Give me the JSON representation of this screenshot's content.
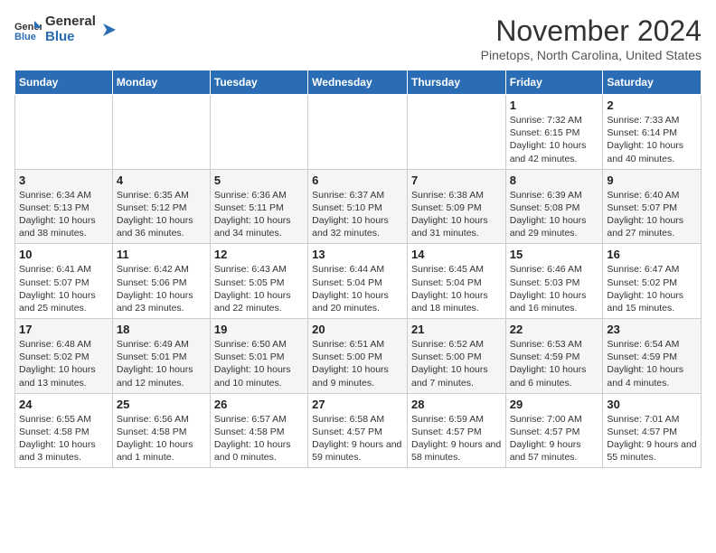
{
  "logo": {
    "line1": "General",
    "line2": "Blue"
  },
  "title": "November 2024",
  "subtitle": "Pinetops, North Carolina, United States",
  "days_of_week": [
    "Sunday",
    "Monday",
    "Tuesday",
    "Wednesday",
    "Thursday",
    "Friday",
    "Saturday"
  ],
  "weeks": [
    [
      {
        "day": "",
        "info": ""
      },
      {
        "day": "",
        "info": ""
      },
      {
        "day": "",
        "info": ""
      },
      {
        "day": "",
        "info": ""
      },
      {
        "day": "",
        "info": ""
      },
      {
        "day": "1",
        "info": "Sunrise: 7:32 AM\nSunset: 6:15 PM\nDaylight: 10 hours and 42 minutes."
      },
      {
        "day": "2",
        "info": "Sunrise: 7:33 AM\nSunset: 6:14 PM\nDaylight: 10 hours and 40 minutes."
      }
    ],
    [
      {
        "day": "3",
        "info": "Sunrise: 6:34 AM\nSunset: 5:13 PM\nDaylight: 10 hours and 38 minutes."
      },
      {
        "day": "4",
        "info": "Sunrise: 6:35 AM\nSunset: 5:12 PM\nDaylight: 10 hours and 36 minutes."
      },
      {
        "day": "5",
        "info": "Sunrise: 6:36 AM\nSunset: 5:11 PM\nDaylight: 10 hours and 34 minutes."
      },
      {
        "day": "6",
        "info": "Sunrise: 6:37 AM\nSunset: 5:10 PM\nDaylight: 10 hours and 32 minutes."
      },
      {
        "day": "7",
        "info": "Sunrise: 6:38 AM\nSunset: 5:09 PM\nDaylight: 10 hours and 31 minutes."
      },
      {
        "day": "8",
        "info": "Sunrise: 6:39 AM\nSunset: 5:08 PM\nDaylight: 10 hours and 29 minutes."
      },
      {
        "day": "9",
        "info": "Sunrise: 6:40 AM\nSunset: 5:07 PM\nDaylight: 10 hours and 27 minutes."
      }
    ],
    [
      {
        "day": "10",
        "info": "Sunrise: 6:41 AM\nSunset: 5:07 PM\nDaylight: 10 hours and 25 minutes."
      },
      {
        "day": "11",
        "info": "Sunrise: 6:42 AM\nSunset: 5:06 PM\nDaylight: 10 hours and 23 minutes."
      },
      {
        "day": "12",
        "info": "Sunrise: 6:43 AM\nSunset: 5:05 PM\nDaylight: 10 hours and 22 minutes."
      },
      {
        "day": "13",
        "info": "Sunrise: 6:44 AM\nSunset: 5:04 PM\nDaylight: 10 hours and 20 minutes."
      },
      {
        "day": "14",
        "info": "Sunrise: 6:45 AM\nSunset: 5:04 PM\nDaylight: 10 hours and 18 minutes."
      },
      {
        "day": "15",
        "info": "Sunrise: 6:46 AM\nSunset: 5:03 PM\nDaylight: 10 hours and 16 minutes."
      },
      {
        "day": "16",
        "info": "Sunrise: 6:47 AM\nSunset: 5:02 PM\nDaylight: 10 hours and 15 minutes."
      }
    ],
    [
      {
        "day": "17",
        "info": "Sunrise: 6:48 AM\nSunset: 5:02 PM\nDaylight: 10 hours and 13 minutes."
      },
      {
        "day": "18",
        "info": "Sunrise: 6:49 AM\nSunset: 5:01 PM\nDaylight: 10 hours and 12 minutes."
      },
      {
        "day": "19",
        "info": "Sunrise: 6:50 AM\nSunset: 5:01 PM\nDaylight: 10 hours and 10 minutes."
      },
      {
        "day": "20",
        "info": "Sunrise: 6:51 AM\nSunset: 5:00 PM\nDaylight: 10 hours and 9 minutes."
      },
      {
        "day": "21",
        "info": "Sunrise: 6:52 AM\nSunset: 5:00 PM\nDaylight: 10 hours and 7 minutes."
      },
      {
        "day": "22",
        "info": "Sunrise: 6:53 AM\nSunset: 4:59 PM\nDaylight: 10 hours and 6 minutes."
      },
      {
        "day": "23",
        "info": "Sunrise: 6:54 AM\nSunset: 4:59 PM\nDaylight: 10 hours and 4 minutes."
      }
    ],
    [
      {
        "day": "24",
        "info": "Sunrise: 6:55 AM\nSunset: 4:58 PM\nDaylight: 10 hours and 3 minutes."
      },
      {
        "day": "25",
        "info": "Sunrise: 6:56 AM\nSunset: 4:58 PM\nDaylight: 10 hours and 1 minute."
      },
      {
        "day": "26",
        "info": "Sunrise: 6:57 AM\nSunset: 4:58 PM\nDaylight: 10 hours and 0 minutes."
      },
      {
        "day": "27",
        "info": "Sunrise: 6:58 AM\nSunset: 4:57 PM\nDaylight: 9 hours and 59 minutes."
      },
      {
        "day": "28",
        "info": "Sunrise: 6:59 AM\nSunset: 4:57 PM\nDaylight: 9 hours and 58 minutes."
      },
      {
        "day": "29",
        "info": "Sunrise: 7:00 AM\nSunset: 4:57 PM\nDaylight: 9 hours and 57 minutes."
      },
      {
        "day": "30",
        "info": "Sunrise: 7:01 AM\nSunset: 4:57 PM\nDaylight: 9 hours and 55 minutes."
      }
    ]
  ]
}
